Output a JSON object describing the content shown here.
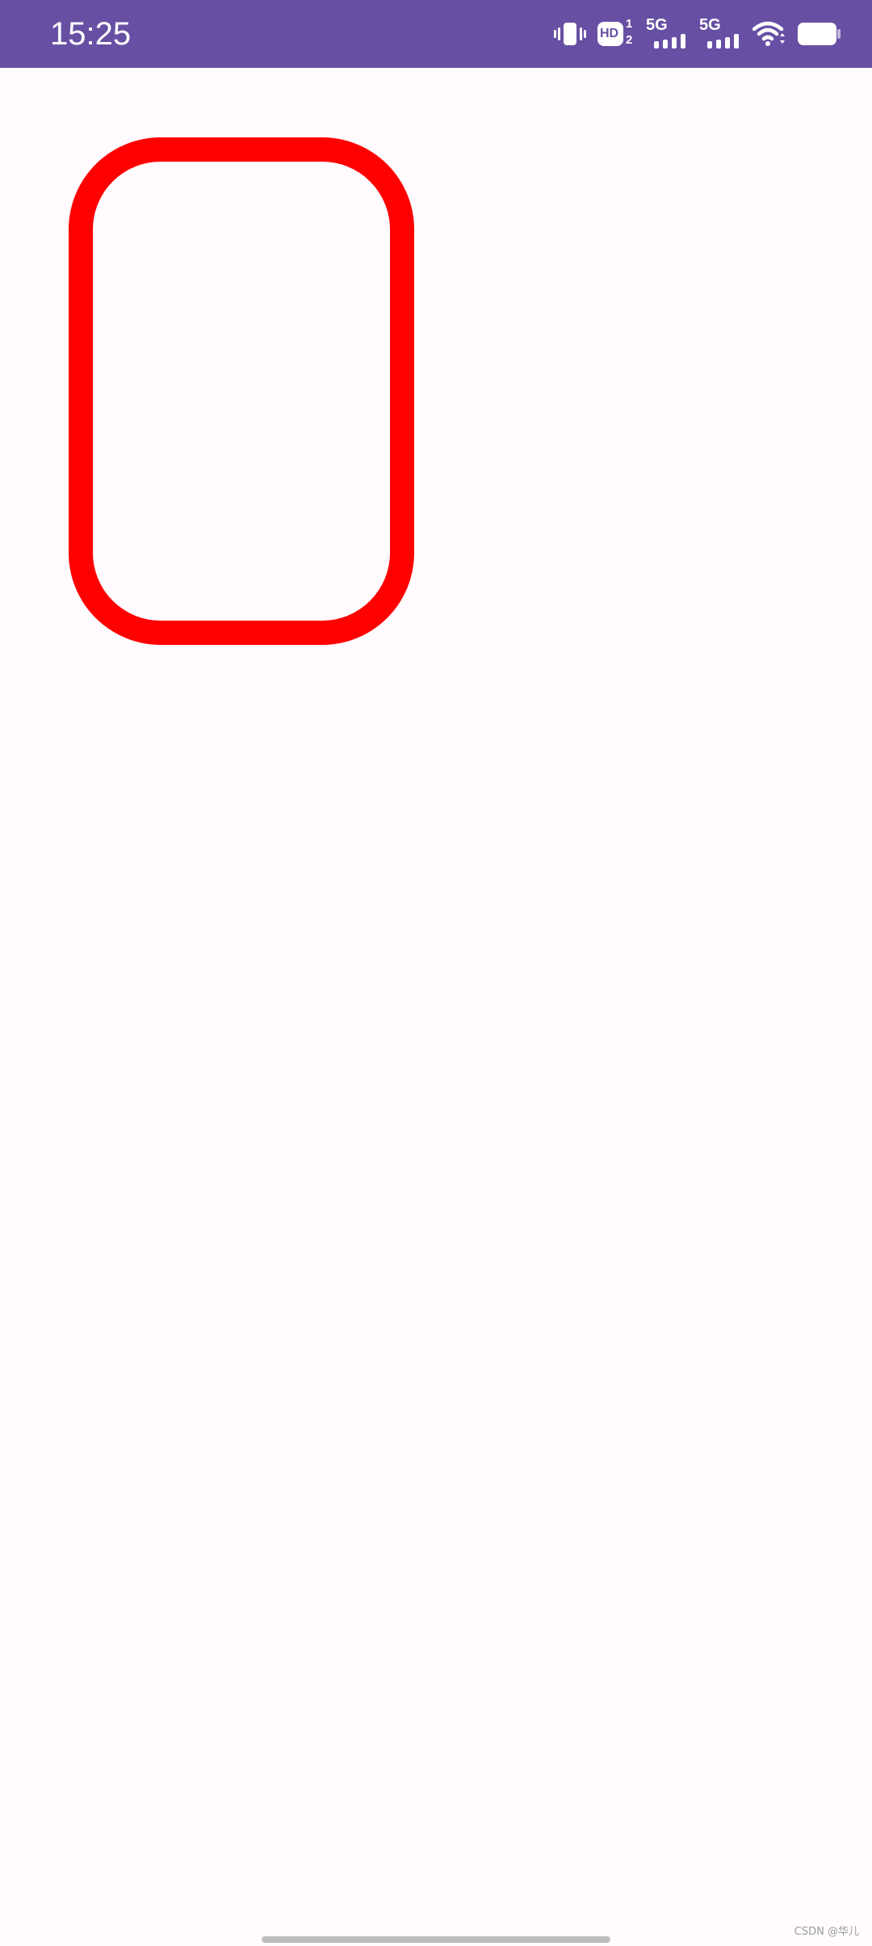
{
  "status_bar": {
    "time": "15:25",
    "background_color": "#6750a4",
    "icons": [
      "vibrate-icon",
      "hd-volte-icon",
      "signal-5g-sim1-icon",
      "signal-5g-sim2-icon",
      "wifi-icon",
      "battery-icon"
    ],
    "hd_label": "HD",
    "hd_sub_top": "1",
    "hd_sub_bottom": "2",
    "sim1_network": "5G",
    "sim2_network": "5G"
  },
  "main": {
    "background_color": "#fffbfe",
    "shape": {
      "kind": "rounded-rectangle-outline",
      "stroke_color": "#ff0000"
    }
  },
  "watermark": {
    "text": "CSDN @华儿"
  }
}
